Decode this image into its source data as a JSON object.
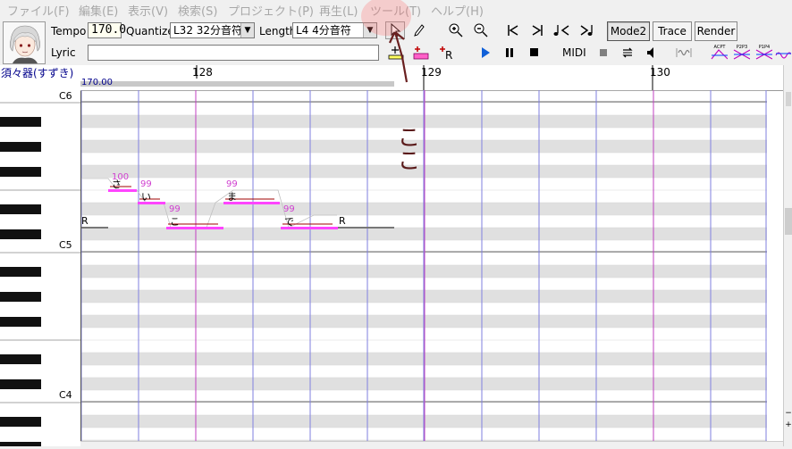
{
  "menu": [
    "ファイル(F)",
    "編集(E)",
    "表示(V)",
    "検索(S)",
    "プロジェクト(P)",
    "再生(L)",
    "ツール(T)",
    "ヘルプ(H)"
  ],
  "toolbar": {
    "tempo_label": "Tempo",
    "tempo_value": "170.0",
    "quantize_label": "Quantize",
    "quantize_value": "L32 32分音符",
    "length_label": "Length",
    "length_value": "L4  4分音符",
    "lyric_label": "Lyric",
    "lyric_value": "",
    "midi_label": "MIDI",
    "mode_label": "Mode2",
    "trace_label": "Trace",
    "render_label": "Render",
    "tiny_labels": [
      "ACPT",
      "P2P3",
      "P1P4"
    ]
  },
  "track": {
    "name": "須々器(すずき)",
    "tempo_marker": "170.00"
  },
  "ruler": {
    "measures": [
      "128",
      "129",
      "130"
    ]
  },
  "keys": {
    "labels": [
      "C6",
      "C5",
      "C4"
    ]
  },
  "notes": [
    {
      "lyric": "さ",
      "velocity": "100"
    },
    {
      "lyric": "い",
      "velocity": "99"
    },
    {
      "lyric": "こ",
      "velocity": "99"
    },
    {
      "lyric": "ま",
      "velocity": "99"
    },
    {
      "lyric": "で",
      "velocity": "99"
    }
  ],
  "rests": [
    "R",
    "R"
  ],
  "annotation": {
    "text": "ここ",
    "color": "#e06070"
  },
  "colors": {
    "note_color": "#ff44ff",
    "beat_line": "#7f7fdf",
    "measure_line": "#c040c0",
    "black_row": "#e0e0e0",
    "track_name": "#00008b"
  }
}
